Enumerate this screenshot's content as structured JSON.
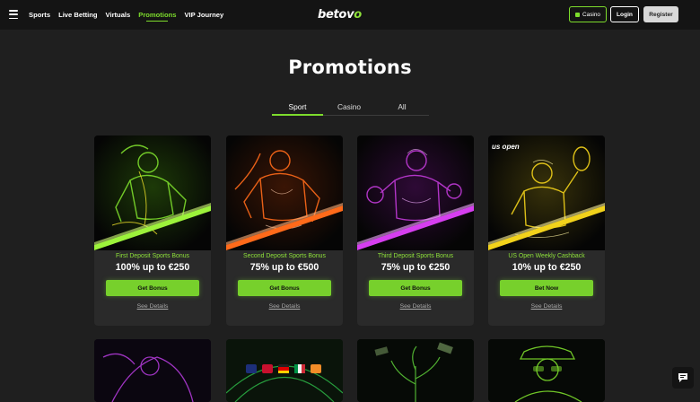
{
  "header": {
    "nav": [
      "Sports",
      "Live Betting",
      "Virtuals",
      "Promotions",
      "VIP Journey"
    ],
    "active_nav": "Promotions",
    "logo": "betovo",
    "casino_label": "Casino",
    "login_label": "Login",
    "register_label": "Register"
  },
  "page": {
    "title": "Promotions",
    "tabs": [
      "Sport",
      "Casino",
      "All"
    ],
    "active_tab": "Sport"
  },
  "promotions": [
    {
      "subtitle": "First Deposit Sports Bonus",
      "amount": "100% up to €250",
      "cta": "Get Bonus",
      "details": "See Details",
      "accent": "#7ddc2c"
    },
    {
      "subtitle": "Second Deposit Sports Bonus",
      "amount": "75% up to €500",
      "cta": "Get Bonus",
      "details": "See Details",
      "accent": "#ff6a1a"
    },
    {
      "subtitle": "Third Deposit Sports Bonus",
      "amount": "75% up to €250",
      "cta": "Get Bonus",
      "details": "See Details",
      "accent": "#c23ad9"
    },
    {
      "subtitle": "US Open Weekly Cashback",
      "amount": "10% up to €250",
      "cta": "Bet Now",
      "details": "See Details",
      "accent": "#f2d21b",
      "badge": "us open"
    }
  ],
  "colors": {
    "accent_green": "#7ddc2c",
    "background": "#1f1f1f",
    "header_bg": "#141414",
    "card_bg": "#2a2a2a"
  },
  "icons": [
    "menu-icon",
    "casino-icon",
    "chat-icon"
  ]
}
